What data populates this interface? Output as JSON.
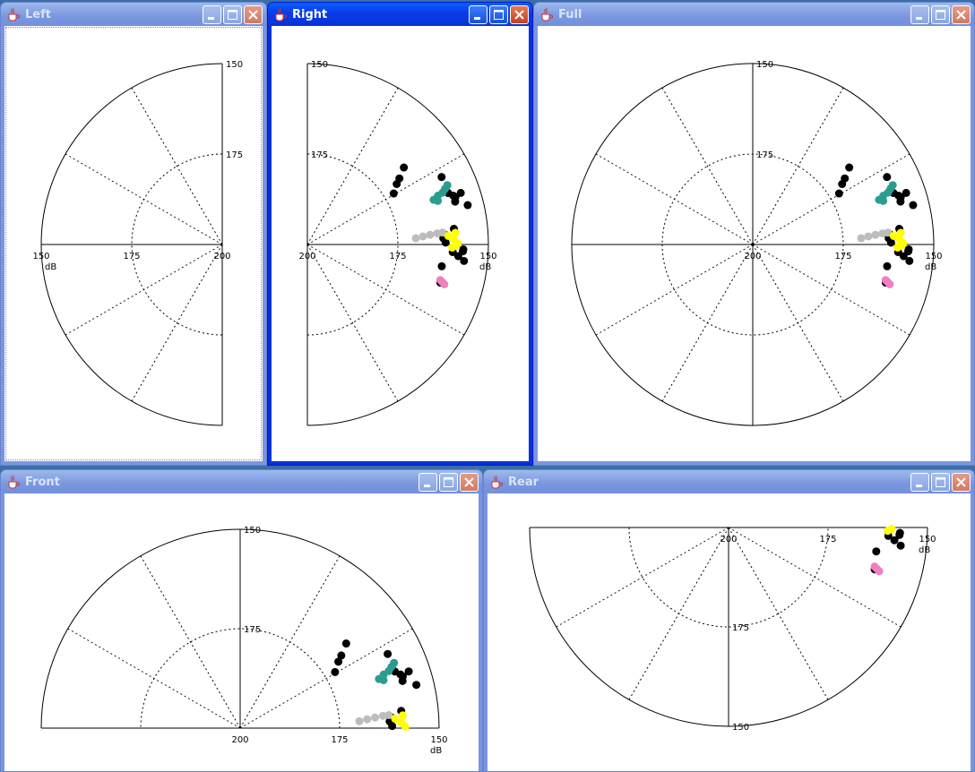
{
  "windows": {
    "left": {
      "title": "Left"
    },
    "right": {
      "title": "Right"
    },
    "full": {
      "title": "Full"
    },
    "front": {
      "title": "Front"
    },
    "rear": {
      "title": "Rear"
    }
  },
  "axis": {
    "unit": "dB",
    "ticks": [
      "150",
      "175",
      "200"
    ]
  },
  "colors": {
    "window_active": "#0831d9",
    "window_inactive": "#7a96df",
    "close_button": "#c5401c",
    "series": {
      "black": "#000000",
      "teal": "#2a9d8f",
      "gray": "#bdbdbd",
      "yellow": "#ffff00",
      "pink": "#f080c0"
    }
  },
  "icons": [
    "java-cup-icon",
    "minimize-icon",
    "maximize-icon",
    "close-icon"
  ],
  "chart_data": {
    "type": "scatter",
    "coordinate_system": "polar",
    "radial_axis": {
      "label": "dB",
      "range": [
        200,
        150
      ],
      "ticks": [
        150,
        175,
        200
      ],
      "inverted": true
    },
    "grid": {
      "radial_rings": [
        175,
        150
      ],
      "spoke_interval_deg": 30,
      "style": "dotted"
    },
    "note_angle": "degrees, 0 = right, counterclockwise",
    "series": [
      {
        "color": "black",
        "points": [
          {
            "angle": 30.6,
            "r": 172.3
          },
          {
            "angle": 34.1,
            "r": 170.2
          },
          {
            "angle": 35.7,
            "r": 168.7
          },
          {
            "angle": 38.6,
            "r": 165.9
          },
          {
            "angle": 26.7,
            "r": 158.5
          },
          {
            "angle": 22.0,
            "r": 158.9
          },
          {
            "angle": 20.1,
            "r": 158.6
          },
          {
            "angle": 18.5,
            "r": 157.5
          },
          {
            "angle": 17.7,
            "r": 157.1
          },
          {
            "angle": 16.2,
            "r": 157.5
          },
          {
            "angle": 18.6,
            "r": 155.3
          },
          {
            "angle": 13.8,
            "r": 154.4
          },
          {
            "angle": 6.1,
            "r": 159.3
          },
          {
            "angle": 4.2,
            "r": 162.0
          },
          {
            "angle": 2.6,
            "r": 162.4
          },
          {
            "angle": 0.8,
            "r": 161.8
          },
          {
            "angle": -1.8,
            "r": 156.9
          },
          {
            "angle": -4.4,
            "r": 158.2
          },
          {
            "angle": -9.2,
            "r": 162.4
          },
          {
            "angle": -16.0,
            "r": 161.8
          },
          {
            "angle": -3.0,
            "r": 159.8
          },
          {
            "angle": -2.5,
            "r": 157.0
          },
          {
            "angle": -6.0,
            "r": 156.5
          }
        ]
      },
      {
        "color": "teal",
        "points": [
          {
            "angle": 19.5,
            "r": 163.0
          },
          {
            "angle": 20.5,
            "r": 161.5
          },
          {
            "angle": 21.0,
            "r": 160.0
          },
          {
            "angle": 22.0,
            "r": 159.0
          },
          {
            "angle": 23.0,
            "r": 158.0
          },
          {
            "angle": 18.5,
            "r": 162.0
          }
        ]
      },
      {
        "color": "gray",
        "points": [
          {
            "angle": 3.3,
            "r": 170.0
          },
          {
            "angle": 4.0,
            "r": 168.0
          },
          {
            "angle": 4.5,
            "r": 166.0
          },
          {
            "angle": 4.9,
            "r": 164.0
          },
          {
            "angle": 5.0,
            "r": 162.5
          }
        ]
      },
      {
        "color": "yellow",
        "points": [
          {
            "angle": 3.5,
            "r": 161.0
          },
          {
            "angle": 2.0,
            "r": 159.5
          },
          {
            "angle": 0.5,
            "r": 158.5
          },
          {
            "angle": -0.5,
            "r": 159.0
          },
          {
            "angle": 4.5,
            "r": 159.0
          },
          {
            "angle": -1.2,
            "r": 160.0
          }
        ]
      },
      {
        "color": "pink",
        "points": [
          {
            "angle": -15.0,
            "r": 162.0
          },
          {
            "angle": -15.6,
            "r": 161.3
          },
          {
            "angle": -16.2,
            "r": 160.6
          }
        ]
      }
    ]
  }
}
